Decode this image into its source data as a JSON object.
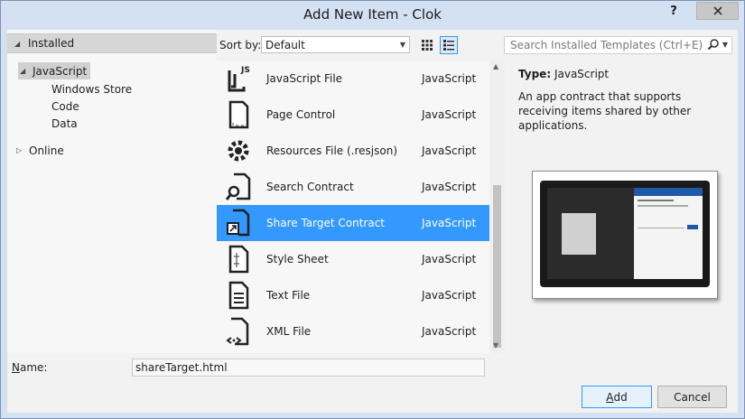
{
  "window": {
    "title": "Add New Item - Clok",
    "help_label": "?"
  },
  "tree": {
    "installed_label": "Installed",
    "items": [
      {
        "label": "JavaScript"
      },
      {
        "label": "Windows Store"
      },
      {
        "label": "Code"
      },
      {
        "label": "Data"
      },
      {
        "label": "Online"
      }
    ]
  },
  "toolbar": {
    "sort_label": "Sort by:",
    "sort_value": "Default",
    "search_placeholder": "Search Installed Templates (Ctrl+E)"
  },
  "templates": [
    {
      "name": "JavaScript File",
      "language": "JavaScript",
      "icon": "javascript-file-icon"
    },
    {
      "name": "Page Control",
      "language": "JavaScript",
      "icon": "page-control-icon"
    },
    {
      "name": "Resources File (.resjson)",
      "language": "JavaScript",
      "icon": "resources-file-icon"
    },
    {
      "name": "Search Contract",
      "language": "JavaScript",
      "icon": "search-contract-icon"
    },
    {
      "name": "Share Target Contract",
      "language": "JavaScript",
      "icon": "share-target-contract-icon",
      "selected": true
    },
    {
      "name": "Style Sheet",
      "language": "JavaScript",
      "icon": "style-sheet-icon"
    },
    {
      "name": "Text File",
      "language": "JavaScript",
      "icon": "text-file-icon"
    },
    {
      "name": "XML File",
      "language": "JavaScript",
      "icon": "xml-file-icon"
    }
  ],
  "info": {
    "type_label": "Type:",
    "type_value": "JavaScript",
    "description": "An app contract that supports receiving items shared by other applications."
  },
  "bottom": {
    "name_label_first": "N",
    "name_label_rest": "ame:",
    "name_value": "shareTarget.html",
    "add_label_first": "A",
    "add_label_rest": "dd",
    "cancel_label": "Cancel"
  },
  "colors": {
    "selection": "#3399ff",
    "dialog_bg": "#f2f2f2",
    "frame": "#d3e1f2"
  }
}
